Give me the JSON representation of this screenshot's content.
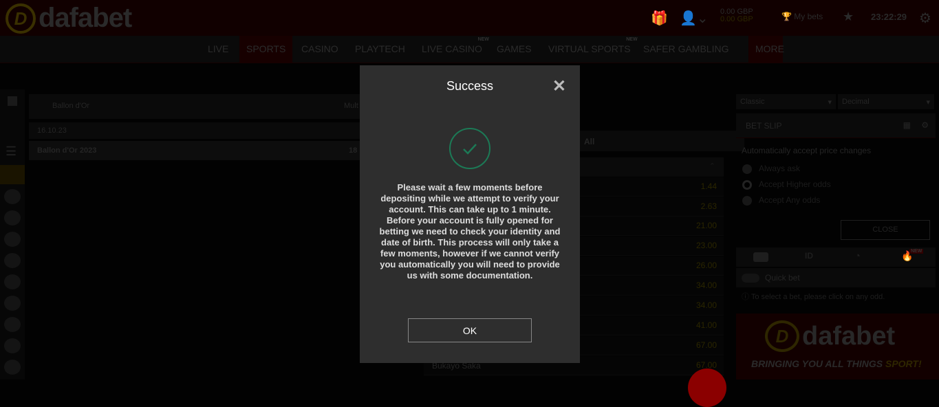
{
  "brand": {
    "name": "dafabet"
  },
  "header": {
    "balance_main": "0.00 GBP",
    "balance_bonus": "0.00 GBP",
    "my_bets": "My bets",
    "clock": "23:22:29"
  },
  "nav": {
    "items": [
      {
        "label": "LIVE"
      },
      {
        "label": "SPORTS",
        "active": true
      },
      {
        "label": "CASINO"
      },
      {
        "label": "PLAYTECH"
      },
      {
        "label": "LIVE CASINO",
        "badge": "NEW"
      },
      {
        "label": "GAMES"
      },
      {
        "label": "VIRTUAL SPORTS",
        "badge": "NEW"
      },
      {
        "label": "SAFER GAMBLING"
      },
      {
        "label": "MORE"
      }
    ]
  },
  "main": {
    "competition": "Ballon d'Or",
    "market_short": "Mult",
    "date": "16.10.23",
    "event": "Ballon d'Or 2023",
    "event_time": "18"
  },
  "market": {
    "filter": "All",
    "odds": [
      "1.44",
      "2.63",
      "21.00",
      "23.00",
      "26.00",
      "34.00",
      "34.00",
      "41.00",
      "67.00",
      "67.00"
    ],
    "last_name": "Bukayo Saka"
  },
  "betslip": {
    "view": "Classic",
    "format": "Decimal",
    "title": "BET SLIP",
    "accept_label": "Automatically accept price changes",
    "options": [
      "Always ask",
      "Accept Higher odds",
      "Accept Any odds"
    ],
    "selected_option": 1,
    "close": "CLOSE",
    "tab_badge": "NEW",
    "quick_bet": "Quick bet",
    "hint": "To select a bet, please click on any odd.",
    "banner_tagline": "BRINGING YOU ALL THINGS ",
    "banner_tagline_accent": "SPORT!"
  },
  "modal": {
    "title": "Success",
    "message": "Please wait a few moments before depositing while we attempt to verify your account. This can take up to 1 minute. Before your account is fully opened for betting we need to check your identity and date of birth. This process will only take a few moments, however if we cannot verify you automatically you will need to provide us with some documentation.",
    "ok": "OK"
  },
  "colors": {
    "success": "#1c7a56",
    "brand_red": "#8b0000"
  }
}
